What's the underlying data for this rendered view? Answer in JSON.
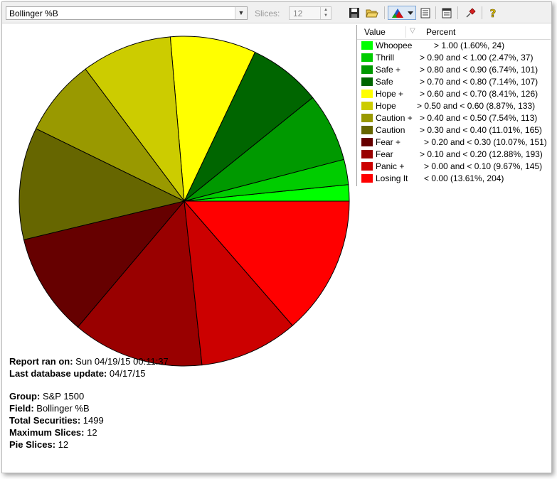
{
  "toolbar": {
    "field_select_value": "Bollinger %B",
    "slices_label": "Slices:",
    "slices_value": "12",
    "icons": [
      "save-icon",
      "open-folder-icon",
      "pie-chart-icon",
      "dropdown-arrow-icon",
      "list-icon",
      "report-icon",
      "pin-icon",
      "help-icon"
    ]
  },
  "legend": {
    "header_value": "Value",
    "header_percent": "Percent",
    "rows": [
      {
        "name": "Whoopee",
        "range": "> 1.00 (1.60%, 24)",
        "color": "#00ff00"
      },
      {
        "name": "Thrill",
        "range": "> 0.90 and < 1.00 (2.47%, 37)",
        "color": "#00cc00"
      },
      {
        "name": "Safe +",
        "range": "> 0.80 and < 0.90 (6.74%, 101)",
        "color": "#009900"
      },
      {
        "name": "Safe",
        "range": "> 0.70 and < 0.80 (7.14%, 107)",
        "color": "#006600"
      },
      {
        "name": "Hope +",
        "range": "> 0.60 and < 0.70 (8.41%, 126)",
        "color": "#ffff00"
      },
      {
        "name": "Hope",
        "range": "> 0.50 and < 0.60 (8.87%, 133)",
        "color": "#cccc00"
      },
      {
        "name": "Caution +",
        "range": "> 0.40 and < 0.50 (7.54%, 113)",
        "color": "#999900"
      },
      {
        "name": "Caution",
        "range": "> 0.30 and < 0.40 (11.01%, 165)",
        "color": "#666600"
      },
      {
        "name": "Fear +",
        "range": "> 0.20 and < 0.30 (10.07%, 151)",
        "color": "#660000"
      },
      {
        "name": "Fear",
        "range": "> 0.10 and < 0.20 (12.88%, 193)",
        "color": "#990000"
      },
      {
        "name": "Panic +",
        "range": "> 0.00 and < 0.10 (9.67%, 145)",
        "color": "#cc0000"
      },
      {
        "name": "Losing It",
        "range": "< 0.00 (13.61%, 204)",
        "color": "#ff0000"
      }
    ]
  },
  "chart_data": {
    "type": "pie",
    "categories": [
      "Whoopee",
      "Thrill",
      "Safe +",
      "Safe",
      "Hope +",
      "Hope",
      "Caution +",
      "Caution",
      "Fear +",
      "Fear",
      "Panic +",
      "Losing It"
    ],
    "values": [
      24,
      37,
      101,
      107,
      126,
      133,
      113,
      165,
      151,
      193,
      145,
      204
    ],
    "percents": [
      1.6,
      2.47,
      6.74,
      7.14,
      8.41,
      8.87,
      7.54,
      11.01,
      10.07,
      12.88,
      9.67,
      13.61
    ],
    "colors": [
      "#00ff00",
      "#00cc00",
      "#009900",
      "#006600",
      "#ffff00",
      "#cccc00",
      "#999900",
      "#666600",
      "#660000",
      "#990000",
      "#cc0000",
      "#ff0000"
    ],
    "start_angle": "3 o'clock",
    "direction": "counter-clockwise",
    "legend": "top-right"
  },
  "report": {
    "ran_label": "Report ran on:",
    "ran_value": " Sun 04/19/15 00:11:37",
    "db_label": "Last database update:",
    "db_value": " 04/17/15",
    "group_label": "Group:",
    "group_value": " S&P 1500",
    "field_label": "Field:",
    "field_value": " Bollinger %B",
    "total_label": "Total Securities:",
    "total_value": " 1499",
    "max_label": "Maximum Slices:",
    "max_value": " 12",
    "pie_label": "Pie Slices:",
    "pie_value": " 12"
  }
}
